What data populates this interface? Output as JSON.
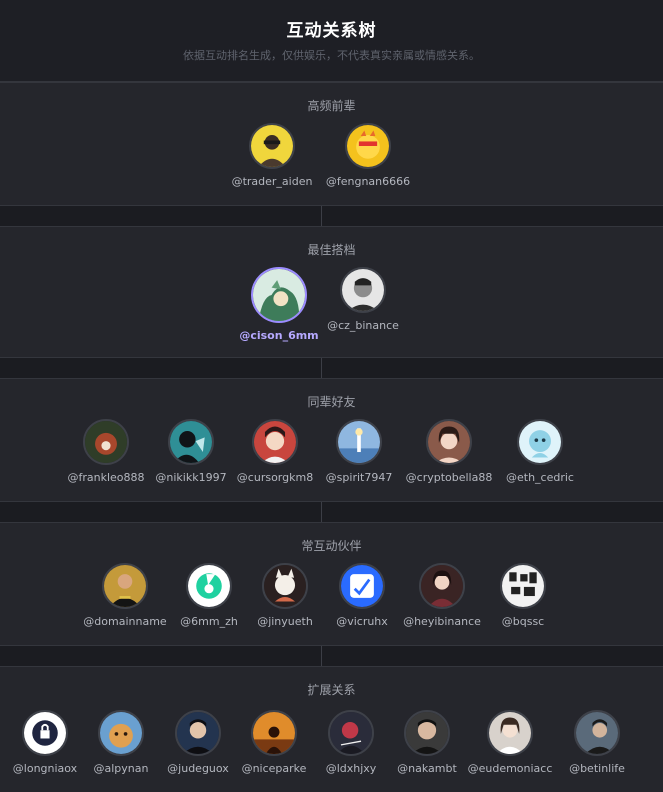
{
  "header": {
    "title": "互动关系树",
    "subtitle": "依据互动排名生成，仅供娱乐，不代表真实亲属或情感关系。"
  },
  "sections": [
    {
      "title": "高频前辈",
      "members": [
        {
          "handle": "@trader_aiden",
          "color": "#f0d63c"
        },
        {
          "handle": "@fengnan6666",
          "color": "#f4c21d"
        }
      ]
    },
    {
      "title": "最佳搭档",
      "members": [
        {
          "handle": "@cison_6mm",
          "color": "#3e7c5a",
          "highlight": true
        },
        {
          "handle": "@cz_binance",
          "color": "#d8d8d8"
        }
      ]
    },
    {
      "title": "同辈好友",
      "members": [
        {
          "handle": "@frankleo888",
          "color": "#6b3a2b"
        },
        {
          "handle": "@nikikk1997",
          "color": "#2f8f96"
        },
        {
          "handle": "@cursorgkm8",
          "color": "#c8463e"
        },
        {
          "handle": "@spirit7947",
          "color": "#4d7fb8"
        },
        {
          "handle": "@cryptobella88",
          "color": "#8a5a4a"
        },
        {
          "handle": "@eth_cedric",
          "color": "#8fd1e6"
        }
      ]
    },
    {
      "title": "常互动伙伴",
      "members": [
        {
          "handle": "@domainname",
          "color": "#c49a3a"
        },
        {
          "handle": "@6mm_zh",
          "color": "#ffffff"
        },
        {
          "handle": "@jinyueth",
          "color": "#d8a07a"
        },
        {
          "handle": "@vicruhx",
          "color": "#2a6bff"
        },
        {
          "handle": "@heyibinance",
          "color": "#7a2d35"
        },
        {
          "handle": "@bqssc",
          "color": "#f2f2f2"
        }
      ]
    },
    {
      "title": "扩展关系",
      "members": [
        {
          "handle": "@longniaox",
          "color": "#ffffff"
        },
        {
          "handle": "@alpynan",
          "color": "#e0a050"
        },
        {
          "handle": "@judeguox",
          "color": "#23344f"
        },
        {
          "handle": "@niceparke",
          "color": "#e08c2b"
        },
        {
          "handle": "@ldxhjxy",
          "color": "#2a2c3a"
        },
        {
          "handle": "@nakambt",
          "color": "#3a3a3a"
        },
        {
          "handle": "@eudemoniacc",
          "color": "#d8d2cc"
        },
        {
          "handle": "@betinlife",
          "color": "#5a6a7a"
        }
      ]
    }
  ]
}
